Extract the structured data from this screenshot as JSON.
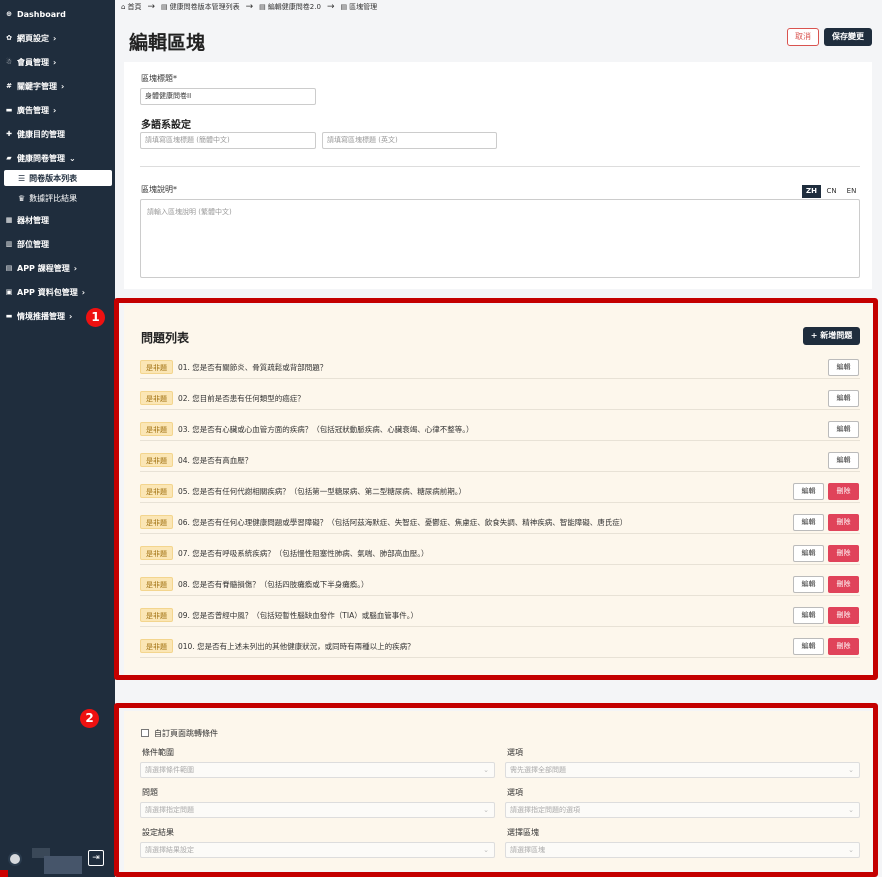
{
  "sidebar": {
    "items": [
      {
        "label": "Dashboard",
        "icon": "dashboard-icon",
        "glyph": "⊕",
        "chevron": ""
      },
      {
        "label": "網頁設定",
        "icon": "gear-icon",
        "glyph": "✿",
        "chevron": "›"
      },
      {
        "label": "會員管理",
        "icon": "users-icon",
        "glyph": "☃",
        "chevron": "›"
      },
      {
        "label": "關鍵字管理",
        "icon": "hashtag-icon",
        "glyph": "#",
        "chevron": "›"
      },
      {
        "label": "廣告管理",
        "icon": "ad-icon",
        "glyph": "▬",
        "chevron": "›"
      },
      {
        "label": "健康目的管理",
        "icon": "heart-icon",
        "glyph": "✚",
        "chevron": ""
      },
      {
        "label": "健康問卷管理",
        "icon": "comment-icon",
        "glyph": "▰",
        "chevron": "⌄"
      },
      {
        "label": "器材管理",
        "icon": "equipment-icon",
        "glyph": "▦",
        "chevron": ""
      },
      {
        "label": "部位管理",
        "icon": "body-part-icon",
        "glyph": "▥",
        "chevron": ""
      },
      {
        "label": "APP 課程管理",
        "icon": "course-icon",
        "glyph": "▤",
        "chevron": "›"
      },
      {
        "label": "APP 資料包管理",
        "icon": "package-icon",
        "glyph": "▣",
        "chevron": "›"
      },
      {
        "label": "情境推播管理",
        "icon": "message-icon",
        "glyph": "▬",
        "chevron": "›"
      }
    ],
    "subitems": [
      {
        "label": "問卷版本列表",
        "icon": "list-icon",
        "glyph": "☰"
      },
      {
        "label": "數據評比結果",
        "icon": "crown-icon",
        "glyph": "♛"
      }
    ],
    "logout_glyph": "⇥"
  },
  "breadcrumb": {
    "home_icon": "⌂",
    "items": [
      "首頁",
      "健康問卷版本管理列表",
      "編輯健康問卷2.0",
      "區塊管理"
    ],
    "sep": "→"
  },
  "page": {
    "title": "編輯區塊",
    "cancel_label": "取消",
    "save_label": "保存變更"
  },
  "form": {
    "block_title_label": "區塊標題*",
    "block_title_value": "身體健康問卷II",
    "multilang_title": "多語系設定",
    "title_cn_placeholder": "請填寫區塊標題 (簡體中文)",
    "title_en_placeholder": "請填寫區塊標題 (英文)",
    "desc_label": "區塊說明*",
    "desc_placeholder": "請輸入區塊說明 (繁體中文)",
    "langs": [
      "ZH",
      "CN",
      "EN"
    ]
  },
  "questions": {
    "title": "問題列表",
    "add_label": "+ 新增問題",
    "edit_label": "編輯",
    "delete_label": "刪除",
    "badges": [
      "1",
      "2"
    ],
    "rows": [
      {
        "type": "是非題",
        "text": "01. 您是否有關節炎、骨質疏鬆或背部問題？",
        "deletable": false
      },
      {
        "type": "是非題",
        "text": "02. 您目前是否患有任何類型的癌症？",
        "deletable": false
      },
      {
        "type": "是非題",
        "text": "03. 您是否有心臟或心血管方面的疾病？（包括冠狀動脈疾病、心臟衰竭、心律不整等。）",
        "deletable": false
      },
      {
        "type": "是非題",
        "text": "04. 您是否有高血壓？",
        "deletable": false
      },
      {
        "type": "是非題",
        "text": "05. 您是否有任何代謝相關疾病？（包括第一型糖尿病、第二型糖尿病、糖尿病前期。）",
        "deletable": true
      },
      {
        "type": "是非題",
        "text": "06. 您是否有任何心理健康問題或學習障礙？（包括阿茲海默症、失智症、憂鬱症、焦慮症、飲食失調、精神疾病、智能障礙、唐氏症）",
        "deletable": true
      },
      {
        "type": "是非題",
        "text": "07. 您是否有呼吸系統疾病？（包括慢性阻塞性肺病、氣喘、肺部高血壓。）",
        "deletable": true
      },
      {
        "type": "是非題",
        "text": "08. 您是否有脊髓損傷？（包括四肢癱瘓或下半身癱瘓。）",
        "deletable": true
      },
      {
        "type": "是非題",
        "text": "09. 您是否曾經中風？（包括短暫性腦缺血發作（TIA）或腦血管事件。）",
        "deletable": true
      },
      {
        "type": "是非題",
        "text": "010. 您是否有上述未列出的其他健康狀況，或同時有兩種以上的疾病？",
        "deletable": true
      }
    ]
  },
  "conditions": {
    "custom_jump_label": "自訂頁面跳轉條件",
    "fields": [
      {
        "label": "條件範圍",
        "placeholder": "請選擇條件範圍"
      },
      {
        "label": "選項",
        "placeholder": "需先選擇全部問題"
      },
      {
        "label": "問題",
        "placeholder": "請選擇指定問題"
      },
      {
        "label": "選項",
        "placeholder": "請選擇指定問題的選項"
      },
      {
        "label": "設定結果",
        "placeholder": "請選擇結果設定"
      },
      {
        "label": "選擇區塊",
        "placeholder": "請選擇區塊"
      }
    ],
    "caret": "⌄"
  },
  "colors": {
    "sidebar_bg": "#1f2d3d",
    "highlight_outline": "#c40000",
    "delete_btn": "#e0435a",
    "tag_bg": "#fbe6b5"
  }
}
